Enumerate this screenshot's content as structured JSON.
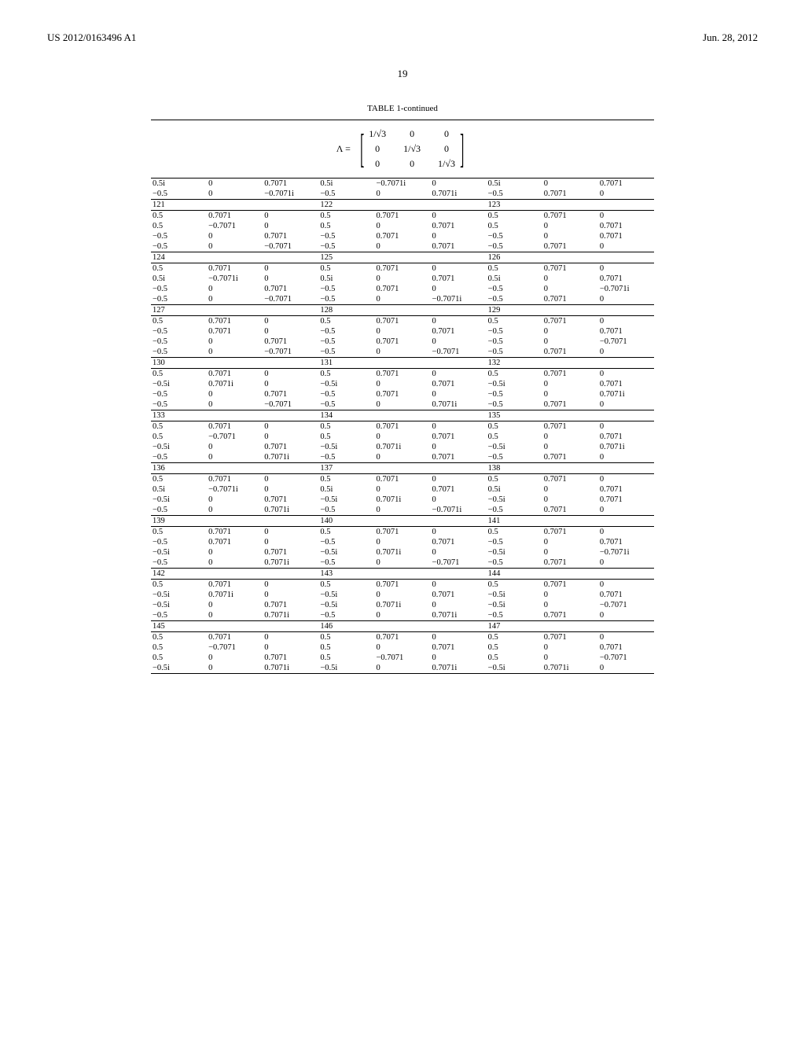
{
  "header": {
    "pub_number": "US 2012/0163496 A1",
    "pub_date": "Jun. 28, 2012"
  },
  "page_number": "19",
  "table_title": "TABLE 1-continued",
  "matrix": {
    "label": "Λ =",
    "cells": [
      "1/√3",
      "0",
      "0",
      "0",
      "1/√3",
      "0",
      "0",
      "0",
      "1/√3"
    ]
  },
  "pre_block": {
    "rows": [
      [
        "0.5i",
        "0",
        "0.7071",
        "0.5i",
        "−0.7071i",
        "0",
        "0.5i",
        "0",
        "0.7071"
      ],
      [
        "−0.5",
        "0",
        "−0.7071i",
        "−0.5",
        "0",
        "0.7071i",
        "−0.5",
        "0.7071",
        "0"
      ]
    ]
  },
  "groups": [
    {
      "ids": [
        "121",
        "122",
        "123"
      ],
      "rows": [
        [
          "0.5",
          "0.7071",
          "0",
          "0.5",
          "0.7071",
          "0",
          "0.5",
          "0.7071",
          "0"
        ],
        [
          "0.5",
          "−0.7071",
          "0",
          "0.5",
          "0",
          "0.7071",
          "0.5",
          "0",
          "0.7071"
        ],
        [
          "−0.5",
          "0",
          "0.7071",
          "−0.5",
          "0.7071",
          "0",
          "−0.5",
          "0",
          "0.7071"
        ],
        [
          "−0.5",
          "0",
          "−0.7071",
          "−0.5",
          "0",
          "0.7071",
          "−0.5",
          "0.7071",
          "0"
        ]
      ]
    },
    {
      "ids": [
        "124",
        "125",
        "126"
      ],
      "rows": [
        [
          "0.5",
          "0.7071",
          "0",
          "0.5",
          "0.7071",
          "0",
          "0.5",
          "0.7071",
          "0"
        ],
        [
          "0.5i",
          "−0.7071i",
          "0",
          "0.5i",
          "0",
          "0.7071",
          "0.5i",
          "0",
          "0.7071"
        ],
        [
          "−0.5",
          "0",
          "0.7071",
          "−0.5",
          "0.7071",
          "0",
          "−0.5",
          "0",
          "−0.7071i"
        ],
        [
          "−0.5",
          "0",
          "−0.7071",
          "−0.5",
          "0",
          "−0.7071i",
          "−0.5",
          "0.7071",
          "0"
        ]
      ]
    },
    {
      "ids": [
        "127",
        "128",
        "129"
      ],
      "rows": [
        [
          "0.5",
          "0.7071",
          "0",
          "0.5",
          "0.7071",
          "0",
          "0.5",
          "0.7071",
          "0"
        ],
        [
          "−0.5",
          "0.7071",
          "0",
          "−0.5",
          "0",
          "0.7071",
          "−0.5",
          "0",
          "0.7071"
        ],
        [
          "−0.5",
          "0",
          "0.7071",
          "−0.5",
          "0.7071",
          "0",
          "−0.5",
          "0",
          "−0.7071"
        ],
        [
          "−0.5",
          "0",
          "−0.7071",
          "−0.5",
          "0",
          "−0.7071",
          "−0.5",
          "0.7071",
          "0"
        ]
      ]
    },
    {
      "ids": [
        "130",
        "131",
        "132"
      ],
      "rows": [
        [
          "0.5",
          "0.7071",
          "0",
          "0.5",
          "0.7071",
          "0",
          "0.5",
          "0.7071",
          "0"
        ],
        [
          "−0.5i",
          "0.7071i",
          "0",
          "−0.5i",
          "0",
          "0.7071",
          "−0.5i",
          "0",
          "0.7071"
        ],
        [
          "−0.5",
          "0",
          "0.7071",
          "−0.5",
          "0.7071",
          "0",
          "−0.5",
          "0",
          "0.7071i"
        ],
        [
          "−0.5",
          "0",
          "−0.7071",
          "−0.5",
          "0",
          "0.7071i",
          "−0.5",
          "0.7071",
          "0"
        ]
      ]
    },
    {
      "ids": [
        "133",
        "134",
        "135"
      ],
      "rows": [
        [
          "0.5",
          "0.7071",
          "0",
          "0.5",
          "0.7071",
          "0",
          "0.5",
          "0.7071",
          "0"
        ],
        [
          "0.5",
          "−0.7071",
          "0",
          "0.5",
          "0",
          "0.7071",
          "0.5",
          "0",
          "0.7071"
        ],
        [
          "−0.5i",
          "0",
          "0.7071",
          "−0.5i",
          "0.7071i",
          "0",
          "−0.5i",
          "0",
          "0.7071i"
        ],
        [
          "−0.5",
          "0",
          "0.7071i",
          "−0.5",
          "0",
          "0.7071",
          "−0.5",
          "0.7071",
          "0"
        ]
      ]
    },
    {
      "ids": [
        "136",
        "137",
        "138"
      ],
      "rows": [
        [
          "0.5",
          "0.7071",
          "0",
          "0.5",
          "0.7071",
          "0",
          "0.5",
          "0.7071",
          "0"
        ],
        [
          "0.5i",
          "−0.7071i",
          "0",
          "0.5i",
          "0",
          "0.7071",
          "0.5i",
          "0",
          "0.7071"
        ],
        [
          "−0.5i",
          "0",
          "0.7071",
          "−0.5i",
          "0.7071i",
          "0",
          "−0.5i",
          "0",
          "0.7071"
        ],
        [
          "−0.5",
          "0",
          "0.7071i",
          "−0.5",
          "0",
          "−0.7071i",
          "−0.5",
          "0.7071",
          "0"
        ]
      ]
    },
    {
      "ids": [
        "139",
        "140",
        "141"
      ],
      "rows": [
        [
          "0.5",
          "0.7071",
          "0",
          "0.5",
          "0.7071",
          "0",
          "0.5",
          "0.7071",
          "0"
        ],
        [
          "−0.5",
          "0.7071",
          "0",
          "−0.5",
          "0",
          "0.7071",
          "−0.5",
          "0",
          "0.7071"
        ],
        [
          "−0.5i",
          "0",
          "0.7071",
          "−0.5i",
          "0.7071i",
          "0",
          "−0.5i",
          "0",
          "−0.7071i"
        ],
        [
          "−0.5",
          "0",
          "0.7071i",
          "−0.5",
          "0",
          "−0.7071",
          "−0.5",
          "0.7071",
          "0"
        ]
      ]
    },
    {
      "ids": [
        "142",
        "143",
        "144"
      ],
      "rows": [
        [
          "0.5",
          "0.7071",
          "0",
          "0.5",
          "0.7071",
          "0",
          "0.5",
          "0.7071",
          "0"
        ],
        [
          "−0.5i",
          "0.7071i",
          "0",
          "−0.5i",
          "0",
          "0.7071",
          "−0.5i",
          "0",
          "0.7071"
        ],
        [
          "−0.5i",
          "0",
          "0.7071",
          "−0.5i",
          "0.7071i",
          "0",
          "−0.5i",
          "0",
          "−0.7071"
        ],
        [
          "−0.5",
          "0",
          "0.7071i",
          "−0.5",
          "0",
          "0.7071i",
          "−0.5",
          "0.7071",
          "0"
        ]
      ]
    },
    {
      "ids": [
        "145",
        "146",
        "147"
      ],
      "rows": [
        [
          "0.5",
          "0.7071",
          "0",
          "0.5",
          "0.7071",
          "0",
          "0.5",
          "0.7071",
          "0"
        ],
        [
          "0.5",
          "−0.7071",
          "0",
          "0.5",
          "0",
          "0.7071",
          "0.5",
          "0",
          "0.7071"
        ],
        [
          "0.5",
          "0",
          "0.7071",
          "0.5",
          "−0.7071",
          "0",
          "0.5",
          "0",
          "−0.7071"
        ],
        [
          "−0.5i",
          "0",
          "0.7071i",
          "−0.5i",
          "0",
          "0.7071i",
          "−0.5i",
          "0.7071i",
          "0"
        ]
      ]
    }
  ]
}
